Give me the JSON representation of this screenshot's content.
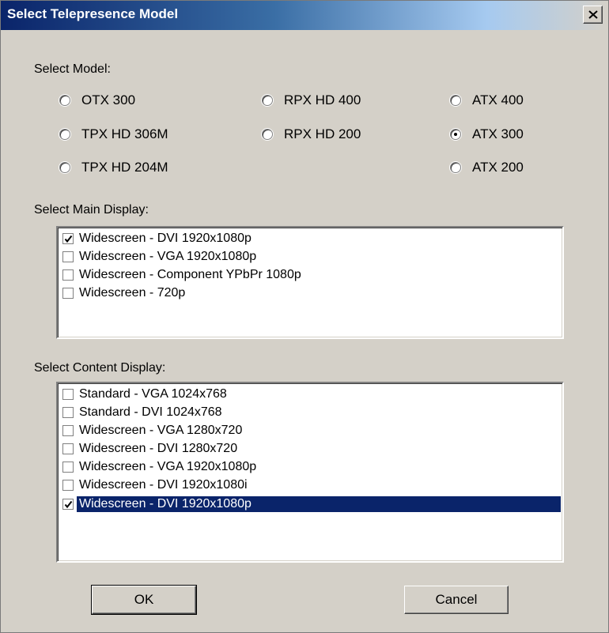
{
  "window": {
    "title": "Select Telepresence Model",
    "close_glyph": "close-icon"
  },
  "model_group": {
    "label": "Select Model:",
    "options": [
      {
        "label": "OTX 300",
        "selected": false
      },
      {
        "label": "RPX HD 400",
        "selected": false
      },
      {
        "label": "ATX 400",
        "selected": false
      },
      {
        "label": "TPX HD 306M",
        "selected": false
      },
      {
        "label": "RPX HD 200",
        "selected": false
      },
      {
        "label": "ATX 300",
        "selected": true
      },
      {
        "label": "TPX HD 204M",
        "selected": false
      },
      {
        "label": "ATX 200",
        "selected": false
      }
    ]
  },
  "main_display": {
    "label": "Select Main Display:",
    "items": [
      {
        "label": "Widescreen - DVI 1920x1080p",
        "checked": true
      },
      {
        "label": "Widescreen - VGA 1920x1080p",
        "checked": false
      },
      {
        "label": "Widescreen - Component YPbPr 1080p",
        "checked": false
      },
      {
        "label": "Widescreen - 720p",
        "checked": false
      }
    ]
  },
  "content_display": {
    "label": "Select Content Display:",
    "items": [
      {
        "label": "Standard - VGA 1024x768",
        "checked": false
      },
      {
        "label": "Standard - DVI 1024x768",
        "checked": false
      },
      {
        "label": "Widescreen - VGA 1280x720",
        "checked": false
      },
      {
        "label": "Widescreen - DVI 1280x720",
        "checked": false
      },
      {
        "label": "Widescreen - VGA 1920x1080p",
        "checked": false
      },
      {
        "label": "Widescreen - DVI 1920x1080i",
        "checked": false
      },
      {
        "label": "Widescreen - DVI 1920x1080p",
        "checked": true,
        "selected": true
      }
    ]
  },
  "buttons": {
    "ok_label": "OK",
    "cancel_label": "Cancel"
  },
  "colors": {
    "title_bar": "#0a246a",
    "selection": "#0a246a",
    "dialog_face": "#d4d0c8"
  }
}
